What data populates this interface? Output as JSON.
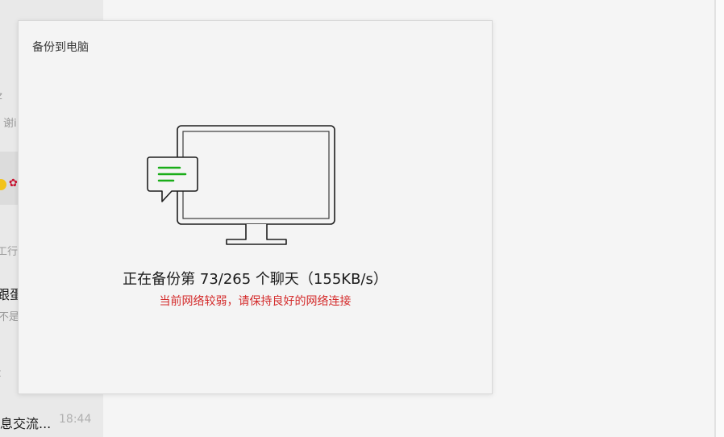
{
  "dialog": {
    "title": "备份到电脑",
    "status": "正在备份第 73/265 个聊天（155KB/s）",
    "warning": "当前网络较弱，请保持良好的网络连接"
  },
  "sidebar_fragments": {
    "f1": "z",
    "f2": "谢i",
    "f3": "工行",
    "f4": "跟蛋",
    "f5": "不是",
    "f6": "t",
    "last_chat_title": "息交流...",
    "last_chat_time": "18:44"
  },
  "colors": {
    "accent_green": "#1aad19",
    "warning_red": "#d42b2b"
  }
}
